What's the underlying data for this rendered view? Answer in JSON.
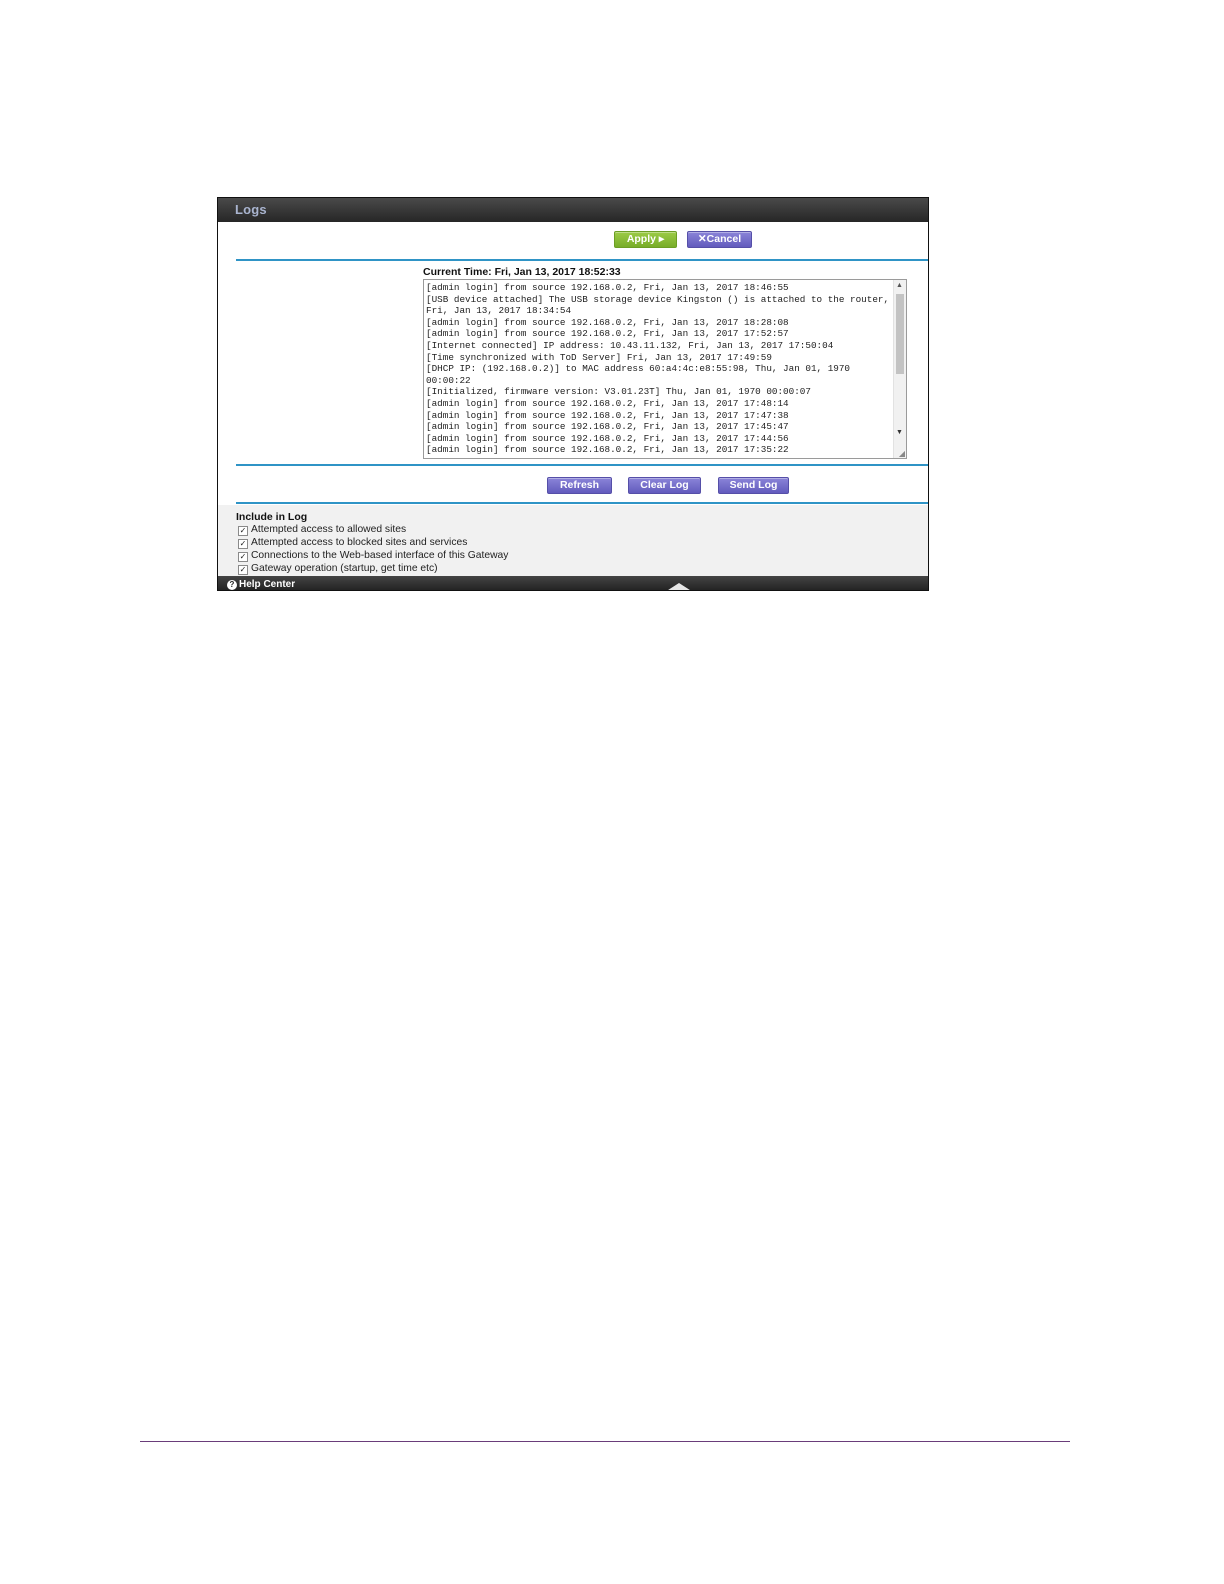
{
  "panel": {
    "title": "Logs",
    "apply_label": "Apply ▸",
    "cancel_label": "✕Cancel",
    "current_time": "Current Time: Fri, Jan 13, 2017 18:52:33",
    "log_text": "[admin login] from source 192.168.0.2, Fri, Jan 13, 2017 18:46:55\n[USB device attached] The USB storage device Kingston () is attached to the router, Fri, Jan 13, 2017 18:34:54\n[admin login] from source 192.168.0.2, Fri, Jan 13, 2017 18:28:08\n[admin login] from source 192.168.0.2, Fri, Jan 13, 2017 17:52:57\n[Internet connected] IP address: 10.43.11.132, Fri, Jan 13, 2017 17:50:04\n[Time synchronized with ToD Server] Fri, Jan 13, 2017 17:49:59\n[DHCP IP: (192.168.0.2)] to MAC address 60:a4:4c:e8:55:98, Thu, Jan 01, 1970 00:00:22\n[Initialized, firmware version: V3.01.23T] Thu, Jan 01, 1970 00:00:07\n[admin login] from source 192.168.0.2, Fri, Jan 13, 2017 17:48:14\n[admin login] from source 192.168.0.2, Fri, Jan 13, 2017 17:47:38\n[admin login] from source 192.168.0.2, Fri, Jan 13, 2017 17:45:47\n[admin login] from source 192.168.0.2, Fri, Jan 13, 2017 17:44:56\n[admin login] from source 192.168.0.2, Fri, Jan 13, 2017 17:35:22",
    "refresh_label": "Refresh",
    "clear_log_label": "Clear Log",
    "send_log_label": "Send Log",
    "include_title": "Include in Log",
    "options": [
      {
        "label": "Attempted access to allowed sites",
        "checked": true
      },
      {
        "label": "Attempted access to blocked sites and services",
        "checked": true
      },
      {
        "label": "Connections to the Web-based interface of this Gateway",
        "checked": true
      },
      {
        "label": "Gateway operation (startup, get time etc)",
        "checked": true
      }
    ],
    "help_label": "Help Center",
    "icons": {
      "help": "help-circle-icon",
      "collapse": "triangle-up-icon",
      "check": "checkmark-icon"
    },
    "colors": {
      "apply": "#86bb35",
      "purple_button": "#6f69c9",
      "divider": "#2f94c6",
      "title_text": "#a9b4cf"
    }
  }
}
